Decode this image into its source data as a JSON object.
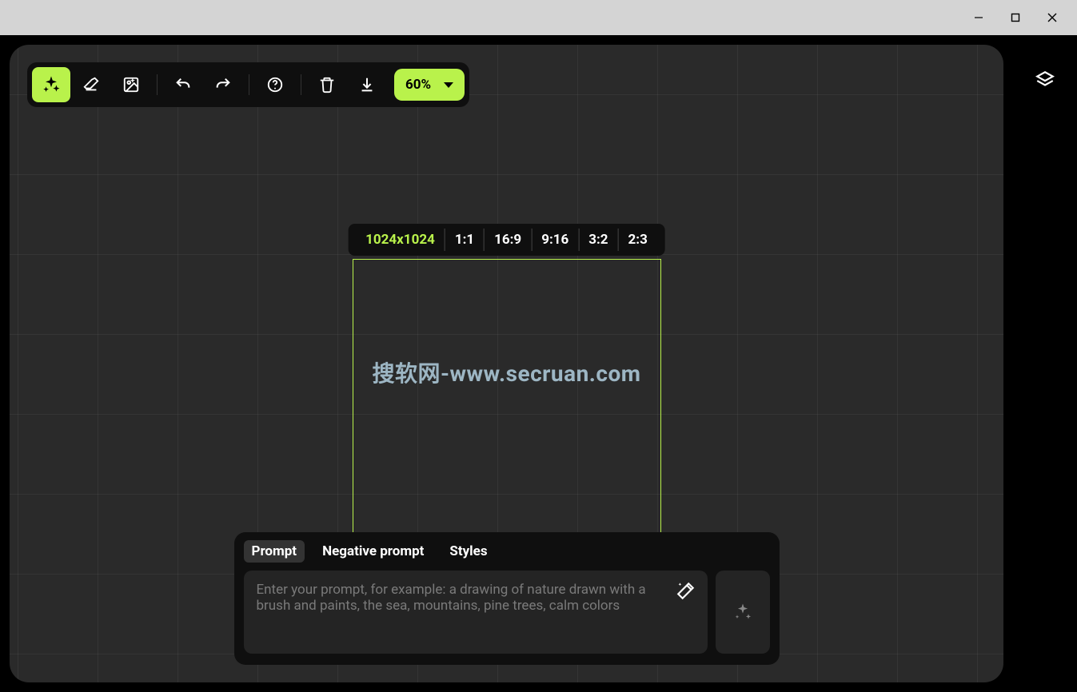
{
  "window": {
    "controls": [
      "minimize",
      "maximize",
      "close"
    ]
  },
  "toolbar": {
    "tools": {
      "sparkle": "sparkle-icon",
      "eraser": "eraser-icon",
      "image": "image-icon",
      "undo": "undo-icon",
      "redo": "redo-icon",
      "help": "help-icon",
      "trash": "trash-icon",
      "download": "download-icon"
    },
    "zoom_label": "60%"
  },
  "right_rail": {
    "layers": "layers-icon"
  },
  "sizebar": {
    "current": "1024x1024",
    "ratios": [
      "1:1",
      "16:9",
      "9:16",
      "3:2",
      "2:3"
    ]
  },
  "canvas": {
    "box_size": "1024x1024"
  },
  "watermark": "搜软网-www.secruan.com",
  "prompt": {
    "tabs": {
      "prompt": "Prompt",
      "negative": "Negative prompt",
      "styles": "Styles"
    },
    "placeholder": "Enter your prompt, for example: a drawing of nature drawn with a brush and paints, the sea, mountains, pine trees, calm colors",
    "value": ""
  },
  "colors": {
    "accent": "#b9f24b",
    "bg": "#2a2a2a",
    "panel": "#0f0f0f"
  }
}
